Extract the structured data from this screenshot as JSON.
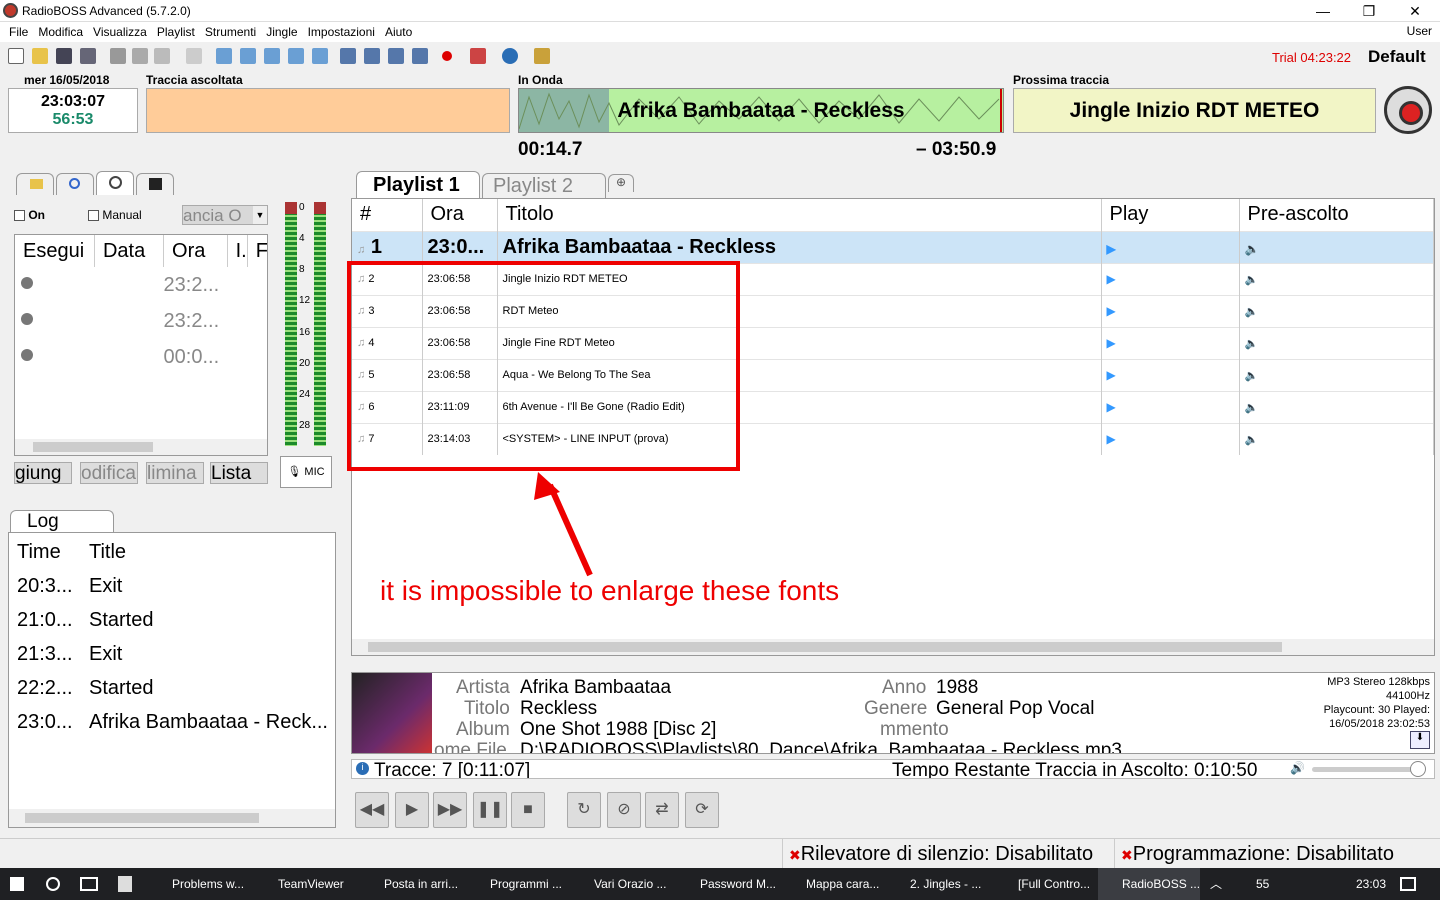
{
  "window": {
    "title": "RadioBOSS Advanced (5.7.2.0)"
  },
  "menu": [
    "File",
    "Modifica",
    "Visualizza",
    "Playlist",
    "Strumenti",
    "Jingle",
    "Impostazioni",
    "Aiuto"
  ],
  "user": "User",
  "status": {
    "trial": "Trial 04:23:22",
    "profile": "Default"
  },
  "header": {
    "date": "mer 16/05/2018",
    "clock": "23:03:07",
    "countdown": "56:53",
    "played_label": "Traccia ascoltata",
    "onair_label": "In Onda",
    "onair_title": "Afrika Bambaataa - Reckless",
    "elapsed": "00:14.7",
    "remaining": "– 03:50.9",
    "next_label": "Prossima traccia",
    "next_title": "Jingle Inizio RDT METEO"
  },
  "scheduler": {
    "on_label": "On",
    "manual_label": "Manual",
    "combo": "ancia O",
    "columns": [
      "Esegui",
      "Data",
      "Ora",
      "I.",
      "F"
    ],
    "rows": [
      {
        "ora": "23:2..."
      },
      {
        "ora": "23:2..."
      },
      {
        "ora": "00:0..."
      }
    ],
    "buttons": [
      "giung",
      "odifica",
      "limina",
      "Lista"
    ]
  },
  "vu": [
    "0",
    "4",
    "8",
    "12",
    "16",
    "20",
    "24",
    "28"
  ],
  "mic": "MIC",
  "log": {
    "tab": "Log",
    "columns": [
      "Time",
      "Title"
    ],
    "rows": [
      {
        "time": "20:3...",
        "title": "Exit"
      },
      {
        "time": "21:0...",
        "title": "Started"
      },
      {
        "time": "21:3...",
        "title": "Exit"
      },
      {
        "time": "22:2...",
        "title": "Started"
      },
      {
        "time": "23:0...",
        "title": "Afrika Bambaataa - Reck..."
      }
    ]
  },
  "playlist": {
    "tabs": [
      "Playlist 1",
      "Playlist 2"
    ],
    "columns": [
      "#",
      "Ora",
      "Titolo",
      "Play",
      "Pre-ascolto"
    ],
    "rows": [
      {
        "n": "1",
        "ora": "23:0...",
        "titolo": "Afrika Bambaataa - Reckless"
      },
      {
        "n": "2",
        "ora": "23:06:58",
        "titolo": "Jingle Inizio RDT METEO"
      },
      {
        "n": "3",
        "ora": "23:06:58",
        "titolo": "RDT Meteo"
      },
      {
        "n": "4",
        "ora": "23:06:58",
        "titolo": "Jingle Fine RDT Meteo"
      },
      {
        "n": "5",
        "ora": "23:06:58",
        "titolo": "Aqua - We Belong To The Sea"
      },
      {
        "n": "6",
        "ora": "23:11:09",
        "titolo": "6th Avenue - I'll Be Gone (Radio Edit)"
      },
      {
        "n": "7",
        "ora": "23:14:03",
        "titolo": "<SYSTEM> - LINE INPUT (prova)"
      }
    ]
  },
  "annotation": "it is impossible to enlarge these fonts",
  "track_info": {
    "artista_l": "Artista",
    "artista": "Afrika Bambaataa",
    "titolo_l": "Titolo",
    "titolo": "Reckless",
    "album_l": "Album",
    "album": "One Shot 1988 [Disc 2]",
    "file_l": "ome File",
    "file": "D:\\RADIOBOSS\\Playlists\\80_Dance\\Afrika_Bambaataa - Reckless.mp3",
    "anno_l": "Anno",
    "anno": "1988",
    "genere_l": "Genere",
    "genere": "General Pop Vocal",
    "commento_l": "mmento",
    "tech": "MP3 Stereo 128kbps",
    "rate": "44100Hz",
    "playcount": "Playcount: 30  Played:",
    "lastplayed": "16/05/2018 23:02:53"
  },
  "statusbar": {
    "tracks": "Tracce: 7 [0:11:07]",
    "remaining": "Tempo Restante Traccia in Ascolto: 0:10:50"
  },
  "bottom": {
    "silence": "Rilevatore di silenzio: Disabilitato",
    "sched": "Programmazione: Disabilitato"
  },
  "taskbar": {
    "items": [
      "Problems w...",
      "TeamViewer",
      "Posta in arri...",
      "Programmi ...",
      "Vari Orazio ...",
      "Password M...",
      "Mappa cara...",
      "2. Jingles - ...",
      "[Full Contro...",
      "RadioBOSS ..."
    ],
    "count": "55",
    "time": "23:03"
  }
}
